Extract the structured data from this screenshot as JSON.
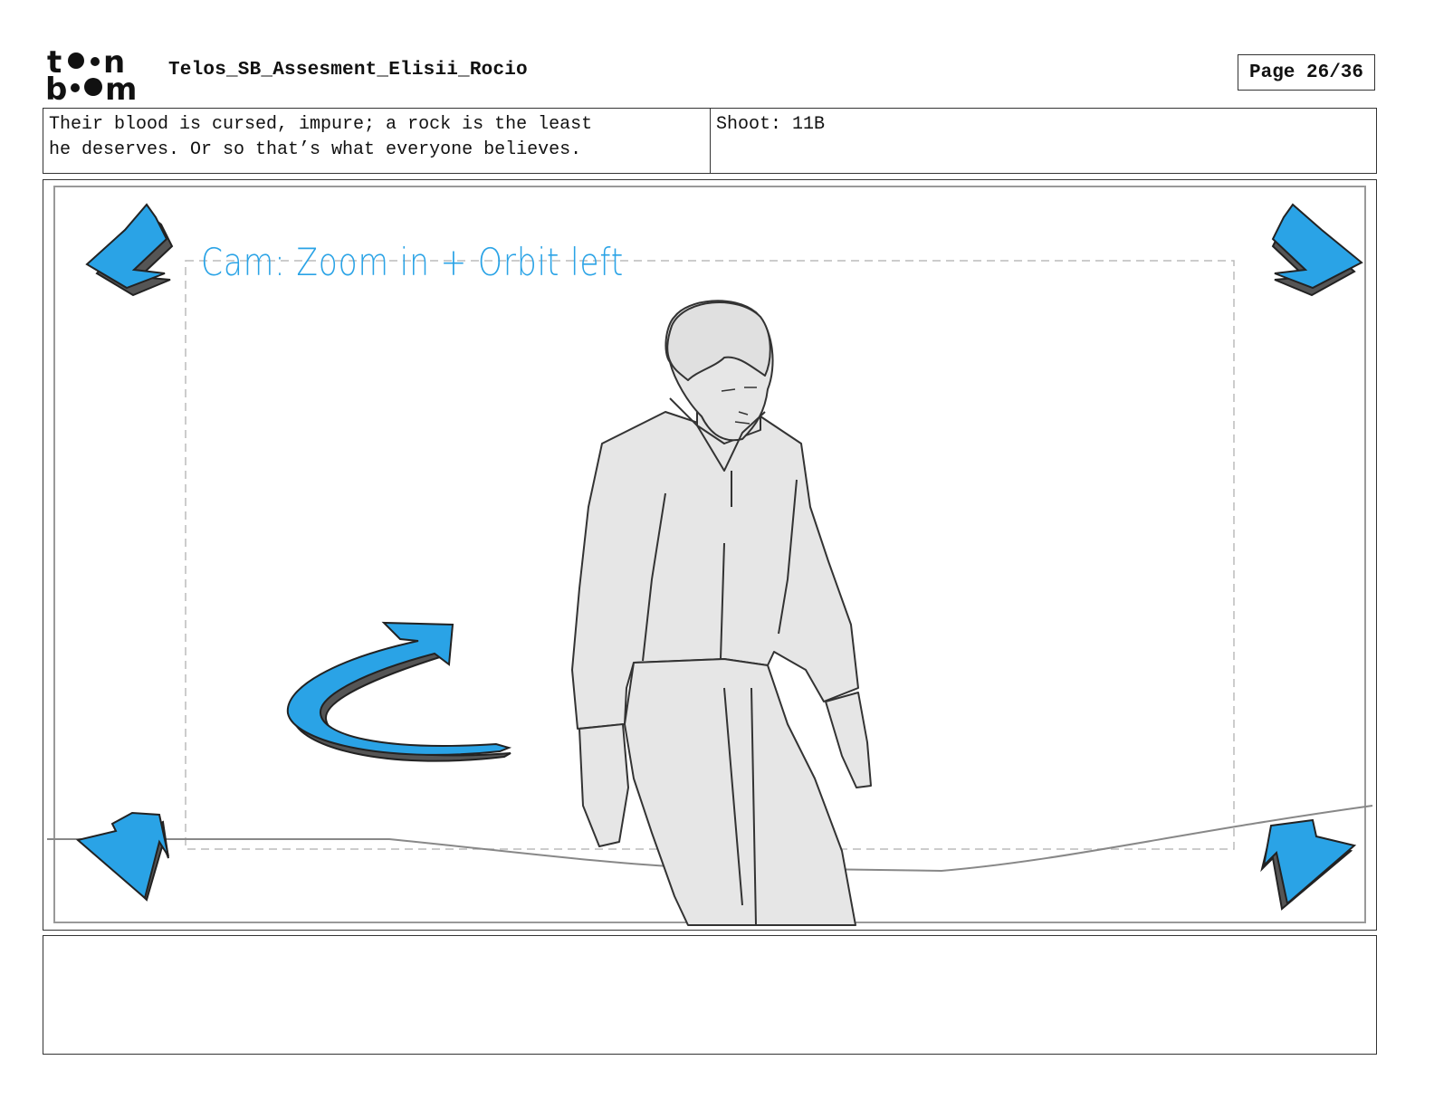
{
  "header": {
    "logo_text": "toon boom",
    "project_title": "Telos_SB_Assesment_Elisii_Rocio",
    "page_label": "Page 26/36"
  },
  "caption": {
    "dialogue": "Their blood is cursed, impure; a rock is the least\nhe deserves. Or so that’s what everyone believes.",
    "shot": "Shoot: 11B"
  },
  "panel": {
    "camera_note": "Cam: Zoom in + Orbit left",
    "icons": [
      "arrow-top-left-icon",
      "arrow-top-right-icon",
      "arrow-bottom-left-icon",
      "arrow-bottom-right-icon",
      "orbit-arrow-icon"
    ],
    "arrow_color": "#2aa3e6",
    "sketch_fill": "#e6e6e6"
  },
  "notes": {
    "text": ""
  }
}
